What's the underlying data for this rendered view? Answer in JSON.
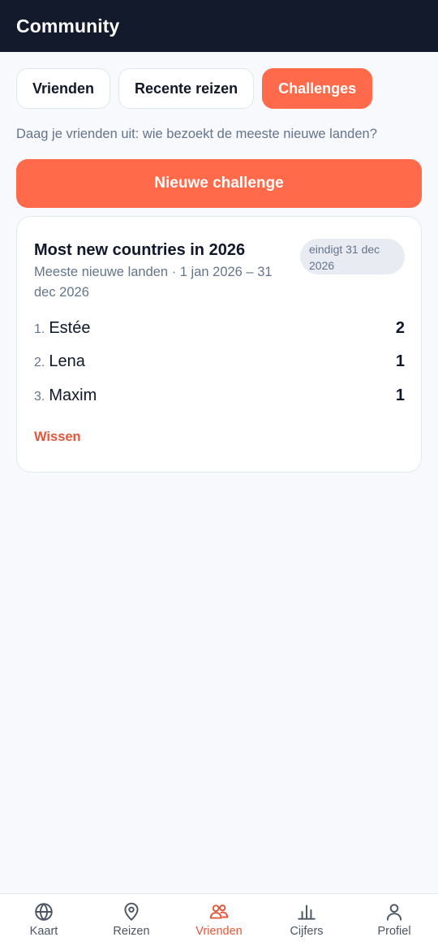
{
  "header": {
    "title": "Community"
  },
  "tabs": [
    {
      "label": "Vrienden",
      "active": false
    },
    {
      "label": "Recente reizen",
      "active": false
    },
    {
      "label": "Challenges",
      "active": true
    }
  ],
  "subtitle": "Daag je vrienden uit: wie bezoekt de meeste nieuwe landen?",
  "new_challenge_label": "Nieuwe challenge",
  "challenge": {
    "title": "Most new countries in 2026",
    "meta": "Meeste nieuwe landen · 1 jan 2026 – 31 dec 2026",
    "badge": "eindigt 31 dec 2026",
    "leaderboard": [
      {
        "rank": "1.",
        "name": "Estée",
        "score": "2"
      },
      {
        "rank": "2.",
        "name": "Lena",
        "score": "1"
      },
      {
        "rank": "3.",
        "name": "Maxim",
        "score": "1"
      }
    ],
    "clear_label": "Wissen"
  },
  "bottom_nav": [
    {
      "label": "Kaart",
      "icon": "globe-icon",
      "active": false
    },
    {
      "label": "Reizen",
      "icon": "map-pin-icon",
      "active": false
    },
    {
      "label": "Vrienden",
      "icon": "friends-icon",
      "active": true
    },
    {
      "label": "Cijfers",
      "icon": "bar-chart-icon",
      "active": false
    },
    {
      "label": "Profiel",
      "icon": "user-icon",
      "active": false
    }
  ],
  "colors": {
    "accent": "#ff6b4a",
    "accent_text": "#e0573a",
    "header_bg": "#121a2c",
    "page_bg": "#f7f9fc"
  }
}
